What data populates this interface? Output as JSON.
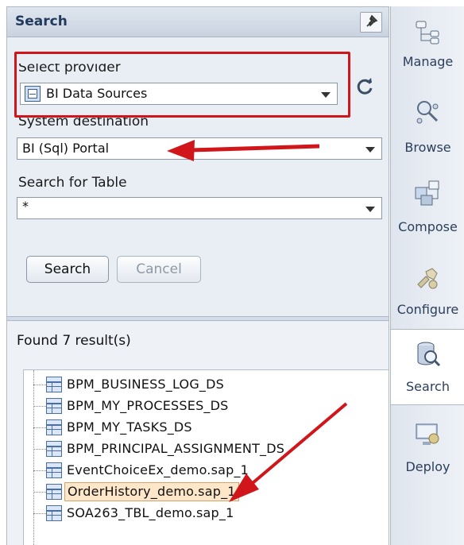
{
  "panel": {
    "title": "Search",
    "select_provider_label": "Select provider",
    "provider_value": "BI Data Sources",
    "system_destination_label": "System destination",
    "system_destination_value": "BI (Sql) Portal",
    "search_table_label": "Search for Table",
    "search_table_value": "*",
    "search_button": "Search",
    "cancel_button": "Cancel",
    "results_label": "Found 7 result(s)",
    "results": [
      "BPM_BUSINESS_LOG_DS",
      "BPM_MY_PROCESSES_DS",
      "BPM_MY_TASKS_DS",
      "BPM_PRINCIPAL_ASSIGNMENT_DS",
      "EventChoiceEx_demo.sap_1",
      "OrderHistory_demo.sap_1",
      "SOA263_TBL_demo.sap_1"
    ],
    "selected_result": "OrderHistory_demo.sap_1"
  },
  "sidebar": {
    "items": [
      {
        "label": "Manage",
        "icon": "manage-icon"
      },
      {
        "label": "Browse",
        "icon": "browse-icon"
      },
      {
        "label": "Compose",
        "icon": "compose-icon"
      },
      {
        "label": "Configure",
        "icon": "configure-icon"
      },
      {
        "label": "Search",
        "icon": "search-db-icon"
      },
      {
        "label": "Deploy",
        "icon": "deploy-icon"
      }
    ],
    "active": "Search"
  },
  "colors": {
    "annotation_red": "#d1161b",
    "panel_bg": "#e9eef5",
    "selected_bg": "#fde7c8"
  }
}
